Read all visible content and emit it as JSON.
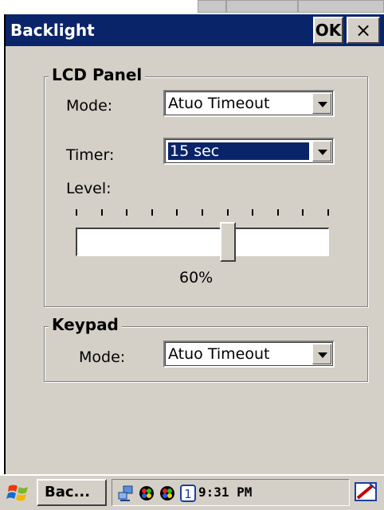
{
  "window": {
    "title": "Backlight",
    "ok_label": "OK",
    "close_label": "×"
  },
  "lcd_panel": {
    "legend": "LCD Panel",
    "mode_label": "Mode:",
    "mode_value": "Atuo Timeout",
    "timer_label": "Timer:",
    "timer_value": "15 sec",
    "level_label": "Level:",
    "level_fraction": 0.6,
    "level_text": "60%",
    "tick_count": 11
  },
  "keypad": {
    "legend": "Keypad",
    "mode_label": "Mode:",
    "mode_value": "Atuo Timeout"
  },
  "taskbar": {
    "task_button_label": "Bac...",
    "tray_icons": [
      "network-icon",
      "color-wheel-icon",
      "color-wheel-icon",
      "input-mode-icon"
    ],
    "input_mode_label": "1",
    "clock": "9:31 PM"
  },
  "colors": {
    "titlebar": "#0a246a",
    "selection": "#0a246a",
    "face": "#d4d0c8"
  }
}
